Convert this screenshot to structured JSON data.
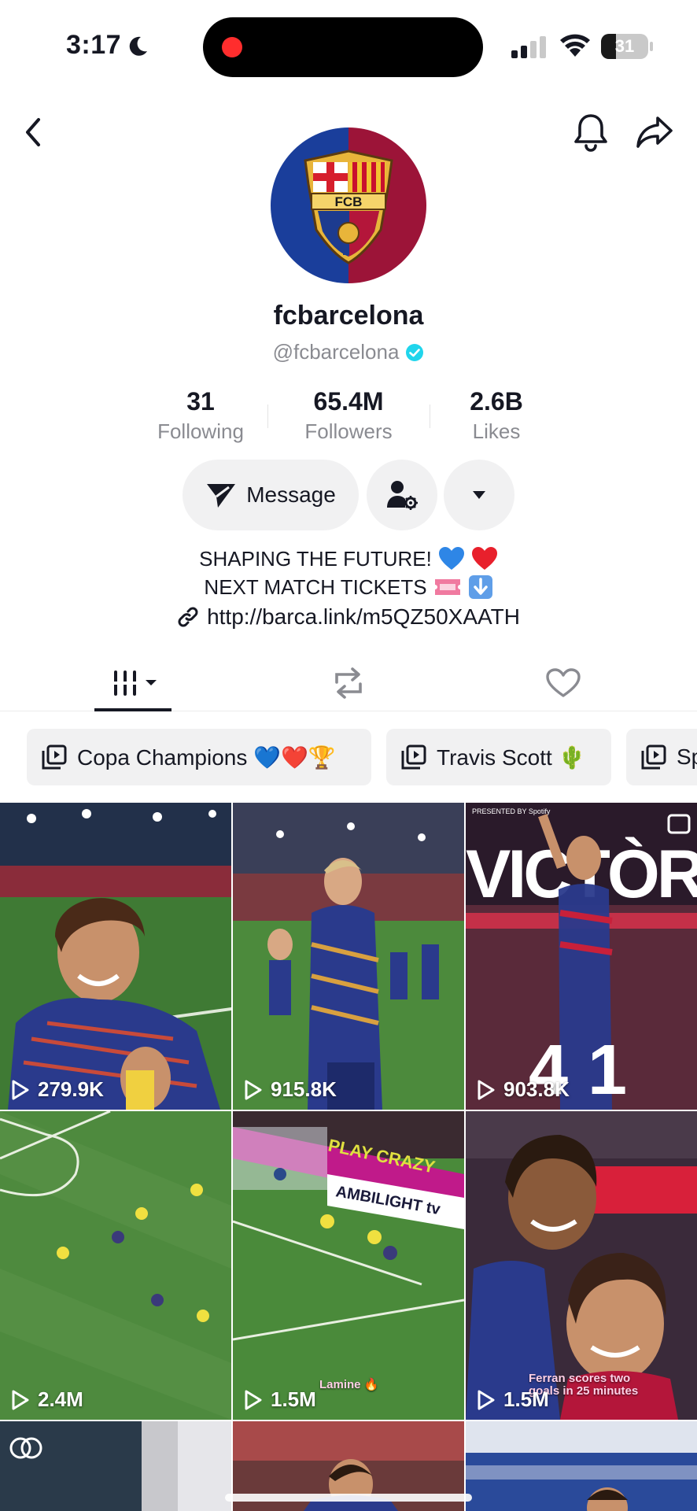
{
  "status_bar": {
    "time": "3:17",
    "battery_percent": "31",
    "battery_level": 0.31,
    "recording_color": "#ff2d2d"
  },
  "nav": {
    "back_icon": "chevron-left-icon",
    "bell_icon": "bell-icon",
    "share_icon": "share-icon"
  },
  "profile": {
    "display_name": "fcbarcelona",
    "handle": "@fcbarcelona",
    "verified_color": "#20d5ec",
    "crest_text": "FCB"
  },
  "stats": [
    {
      "value": "31",
      "label": "Following"
    },
    {
      "value": "65.4M",
      "label": "Followers"
    },
    {
      "value": "2.6B",
      "label": "Likes"
    }
  ],
  "actions": {
    "message_label": "Message",
    "add_friend_icon": "person-gear-icon",
    "more_icon": "caret-down-icon"
  },
  "bio": {
    "line1": "SHAPING THE FUTURE!",
    "line2": "NEXT MATCH TICKETS",
    "link": "http://barca.link/m5QZ50XAATH"
  },
  "tabs": [
    {
      "name": "videos",
      "icon": "grid-icon",
      "active": true
    },
    {
      "name": "reposts",
      "icon": "repost-icon",
      "active": false
    },
    {
      "name": "liked",
      "icon": "heart-icon",
      "active": false
    }
  ],
  "playlists": [
    {
      "label": "Copa Champions 💙❤️🏆"
    },
    {
      "label": "Travis Scott 🌵"
    },
    {
      "label": "Sp"
    }
  ],
  "videos": [
    {
      "views": "279.9K"
    },
    {
      "views": "915.8K"
    },
    {
      "views": "903.8K",
      "title": "VICTÒRIA",
      "score": "4 1",
      "sponsor": "PRESENTED BY Spotify"
    },
    {
      "views": "2.4M"
    },
    {
      "views": "1.5M",
      "board_text": "AMBILIGHT tv",
      "board2": "PLAY CRAZY",
      "caption": "Lamine 🔥"
    },
    {
      "views": "1.5M",
      "caption": "Ferran scores two goals in 25 minutes"
    }
  ]
}
